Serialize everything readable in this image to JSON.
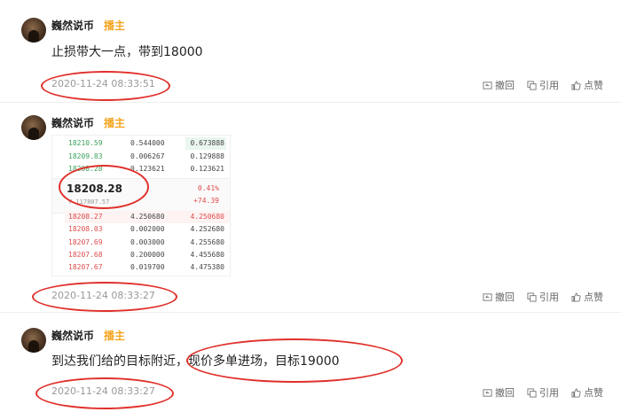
{
  "posts": [
    {
      "author": "巍然说币",
      "badge": "播主",
      "content": "止损带大一点，带到18000",
      "time": "2020-11-24 08:33:51"
    },
    {
      "author": "巍然说币",
      "badge": "播主",
      "time": "2020-11-24 08:33:27",
      "orderbook": {
        "asks": [
          {
            "price": "18210.59",
            "amount": "0.544000",
            "total": "0.673888"
          },
          {
            "price": "18209.83",
            "amount": "0.006267",
            "total": "0.129888"
          },
          {
            "price": "18208.28",
            "amount": "0.123621",
            "total": "0.123621"
          }
        ],
        "last_price": "18208.28",
        "last_price_cny": "¥ 117807.57",
        "change_pct": "0.41%",
        "change_abs": "+74.39",
        "bids": [
          {
            "price": "18208.27",
            "amount": "4.250680",
            "total": "4.250680"
          },
          {
            "price": "18208.03",
            "amount": "0.002000",
            "total": "4.252680"
          },
          {
            "price": "18207.69",
            "amount": "0.003000",
            "total": "4.255680"
          },
          {
            "price": "18207.68",
            "amount": "0.200000",
            "total": "4.455680"
          },
          {
            "price": "18207.67",
            "amount": "0.019700",
            "total": "4.475380"
          }
        ]
      }
    },
    {
      "author": "巍然说币",
      "badge": "播主",
      "content": "到达我们给的目标附近，现价多单进场，目标19000",
      "time": "2020-11-24 08:33:27"
    }
  ],
  "actions": {
    "withdraw": "撤回",
    "quote": "引用",
    "like": "点赞"
  },
  "colors": {
    "badge": "#f5a623",
    "annotation": "#e0302b",
    "ask_green": "#3aa35b",
    "bid_red": "#e04b4b"
  }
}
